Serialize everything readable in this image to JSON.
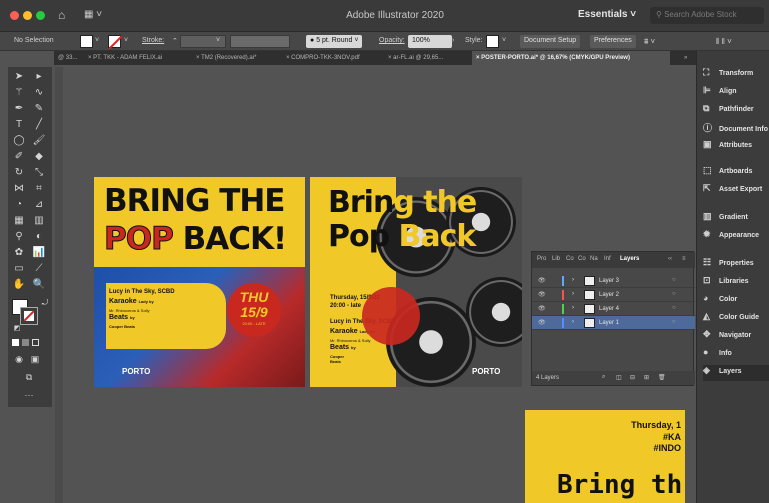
{
  "window": {
    "title": "Adobe Illustrator 2020",
    "workspace": "Essentials",
    "search_placeholder": "Search Adobe Stock"
  },
  "control_bar": {
    "selection": "No Selection",
    "stroke_label": "Stroke:",
    "stroke_value": "⌃",
    "brush": "5 pt. Round",
    "opacity_label": "Opacity:",
    "opacity_value": "100%",
    "style_label": "Style:",
    "document_setup": "Document Setup",
    "preferences": "Preferences"
  },
  "tabs": [
    {
      "label": "@ 33..."
    },
    {
      "label": "PT. TKK - ADAM FELIX.ai"
    },
    {
      "label": "TM2 (Recovered).ai*"
    },
    {
      "label": "COMPRO-TKK-3NOV.pdf"
    },
    {
      "label": "ar-FL.ai @ 29,65..."
    },
    {
      "label": "POSTER-PORTO.ai* @ 16,67% (CMYK/GPU Preview)"
    }
  ],
  "right_dock": [
    {
      "label": "Transform",
      "icon": "transform-icon"
    },
    {
      "label": "Align",
      "icon": "align-icon"
    },
    {
      "label": "Pathfinder",
      "icon": "pathfinder-icon"
    },
    {
      "label": "Document Info",
      "icon": "document-info-icon"
    },
    {
      "label": "Attributes",
      "icon": "attributes-icon"
    },
    {
      "label": "Artboards",
      "icon": "artboards-icon"
    },
    {
      "label": "Asset Export",
      "icon": "asset-export-icon"
    },
    {
      "label": "Gradient",
      "icon": "gradient-icon"
    },
    {
      "label": "Appearance",
      "icon": "appearance-icon"
    },
    {
      "label": "Properties",
      "icon": "properties-icon"
    },
    {
      "label": "Libraries",
      "icon": "libraries-icon"
    },
    {
      "label": "Color",
      "icon": "color-icon"
    },
    {
      "label": "Color Guide",
      "icon": "color-guide-icon"
    },
    {
      "label": "Navigator",
      "icon": "navigator-icon"
    },
    {
      "label": "Info",
      "icon": "info-icon"
    },
    {
      "label": "Layers",
      "icon": "layers-icon"
    }
  ],
  "layers_panel": {
    "tabs": [
      "Pro",
      "Lib",
      "Co",
      "Co",
      "Na",
      "Inf",
      "Layers"
    ],
    "rows": [
      {
        "name": "Layer 3",
        "color": "#5fa8ff"
      },
      {
        "name": "Layer 2",
        "color": "#ff4f4f"
      },
      {
        "name": "Layer 4",
        "color": "#4fd24f"
      },
      {
        "name": "Layer 1",
        "color": "#4f8fff"
      }
    ],
    "count": "4 Layers"
  },
  "artboard1": {
    "line1": "BRING THE",
    "pop": "POP",
    "back": "BACK!",
    "event": "Lucy in The Sky, SCBD",
    "karaoke": "Karaoke",
    "karaoke_by": "Lady by",
    "names": "Mr. Rhinoceros & Solly",
    "beats": "Beats",
    "beats_by": "by",
    "beats_name": "Cooper Beats",
    "day": "THU",
    "date": "15/9",
    "time": "20:00 - LATE",
    "brand": "PORTO"
  },
  "artboard2": {
    "line1a": "Brin",
    "line1b": "g the",
    "line2a": "Pop ",
    "line2b": "Back",
    "date": "Thursday, 15/9/22",
    "time": "20:00 - late",
    "event": "Lucy in The Sky, SCBD",
    "karaoke": "Karaoke",
    "karaoke_by": "Lady by",
    "names": "Mr. Rhinoceros & Solly",
    "beats": "Beats",
    "beats_by": "by",
    "beats_name": "Cooper Beats",
    "brand": "PORTO"
  },
  "artboard3": {
    "line1": "Thursday, 1",
    "line2": "#KA",
    "line3": "#INDO",
    "big": "Bring th"
  },
  "colors": {
    "poster_yellow": "#f0c929",
    "poster_red": "#c9281f",
    "selection_blue": "#4d6a9a"
  }
}
